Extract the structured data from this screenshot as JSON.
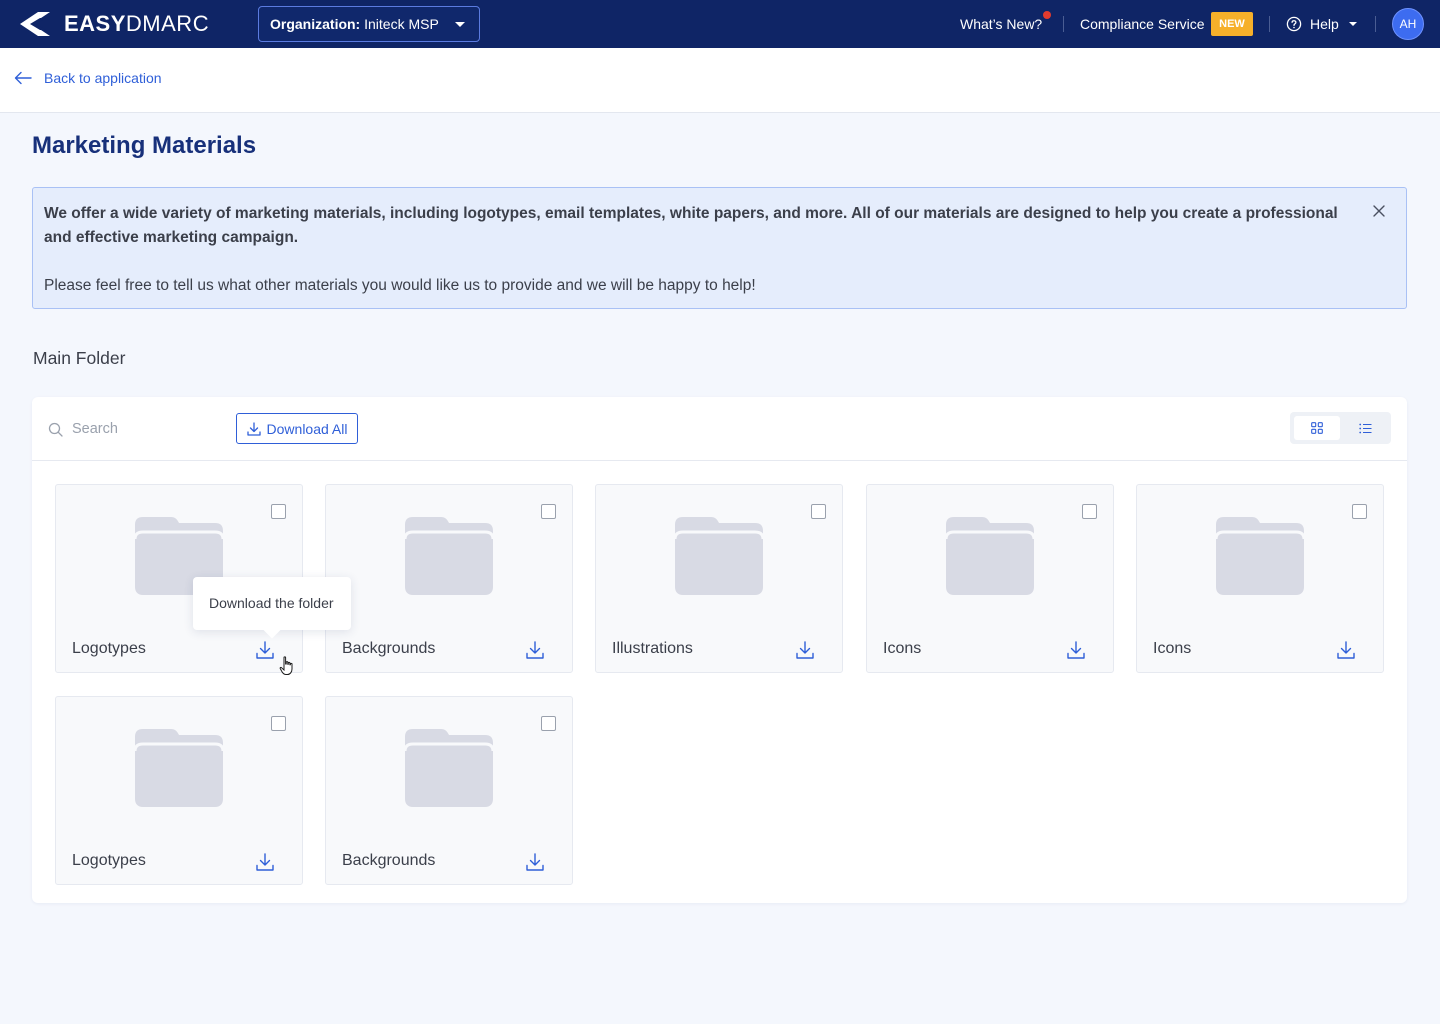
{
  "brand": {
    "logo_easy": "EASY",
    "logo_dmarc": "DMARC"
  },
  "header": {
    "org_label": "Organization:",
    "org_value": "Initeck MSP",
    "whats_new": "What’s New?",
    "compliance": "Compliance Service",
    "new_badge": "NEW",
    "help": "Help",
    "avatar_initials": "AH"
  },
  "nav": {
    "back_label": "Back to application"
  },
  "page": {
    "title": "Marketing Materials",
    "info_strong": "We offer a wide variety of marketing materials, including logotypes, email templates, white papers, and more. All of our materials are designed to help you create a professional and effective marketing campaign.",
    "info_text": "Please feel free to tell us what other materials you would like us to provide and we will be happy to help!",
    "section_title": "Main Folder"
  },
  "toolbar": {
    "search_placeholder": "Search",
    "download_all": "Download All"
  },
  "folders": [
    {
      "name": "Logotypes"
    },
    {
      "name": "Backgrounds"
    },
    {
      "name": "Illustrations"
    },
    {
      "name": "Icons"
    },
    {
      "name": "Icons"
    },
    {
      "name": "Logotypes"
    },
    {
      "name": "Backgrounds"
    }
  ],
  "tooltip": {
    "text": "Download the folder"
  },
  "colors": {
    "nav_bg": "#0f2566",
    "accent": "#2f5fd8",
    "title": "#17307a",
    "badge": "#f6b02a",
    "notification": "#e23b2e",
    "folder": "#d8dae4"
  },
  "icons": [
    "logo-mark-icon",
    "chevron-down-icon",
    "help-circle-icon",
    "arrow-left-icon",
    "close-icon",
    "search-icon",
    "download-icon",
    "grid-view-icon",
    "list-view-icon",
    "folder-icon",
    "checkbox-icon",
    "pointer-cursor-icon"
  ]
}
